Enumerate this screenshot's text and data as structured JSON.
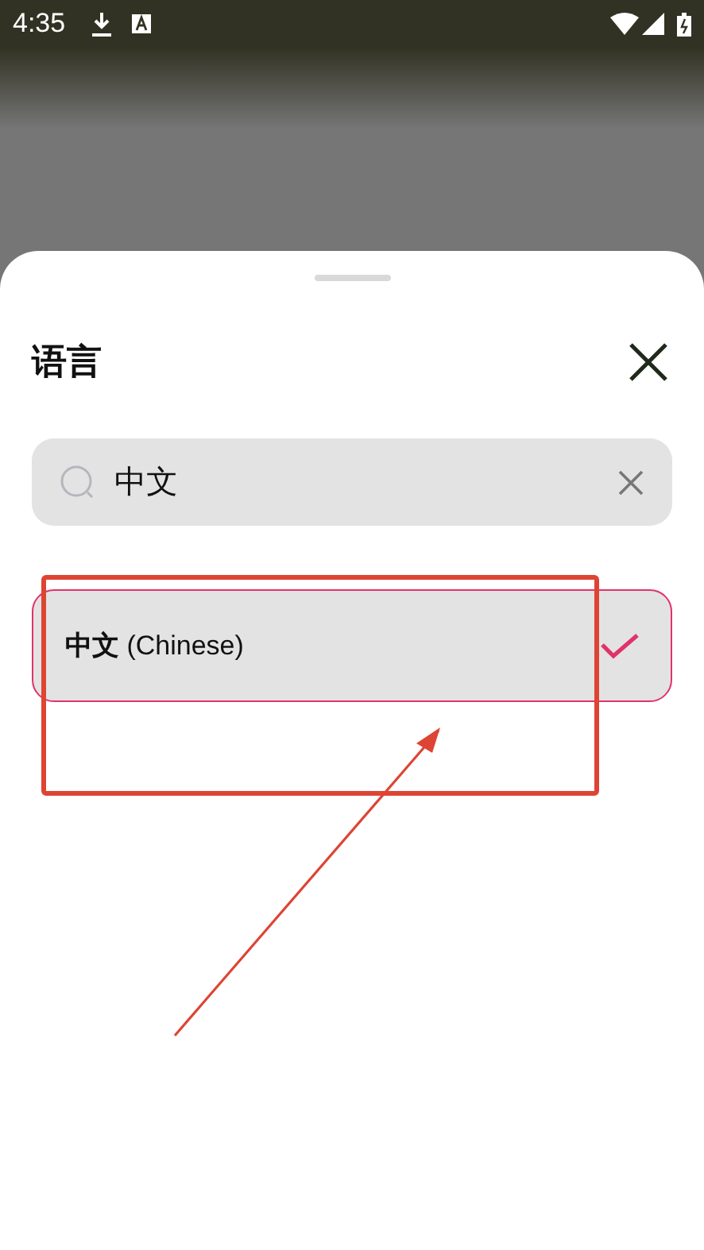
{
  "status_bar": {
    "time": "4:35"
  },
  "sheet": {
    "title": "语言"
  },
  "search": {
    "value": "中文"
  },
  "languages": [
    {
      "label": "**中文** (Chinese)",
      "selected": true
    }
  ]
}
